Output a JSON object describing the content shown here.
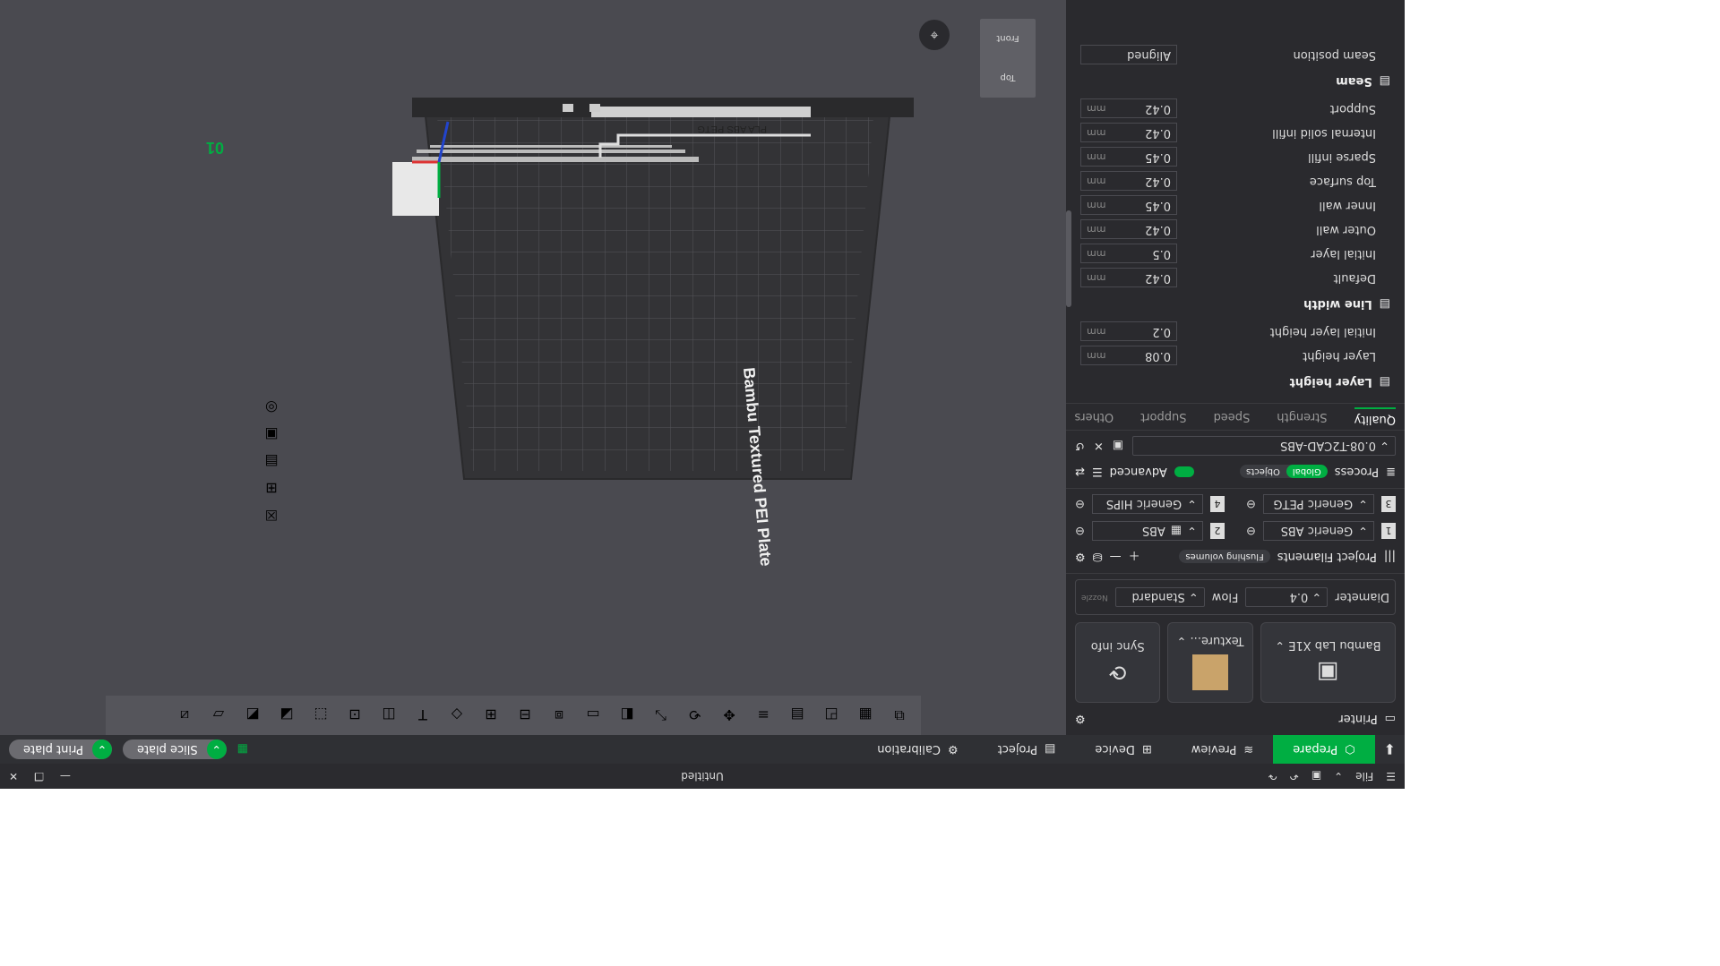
{
  "app": {
    "window_title": "Untitled",
    "menu_label": "File"
  },
  "nav": {
    "tabs": [
      {
        "label": "Prepare",
        "active": true
      },
      {
        "label": "Preview",
        "active": false
      },
      {
        "label": "Device",
        "active": false
      },
      {
        "label": "Project",
        "active": false
      },
      {
        "label": "Calibration",
        "active": false
      }
    ],
    "slice_label": "Slice plate",
    "print_label": "Print plate"
  },
  "printer": {
    "section_label": "Printer",
    "name": "Bambu Lab X1E",
    "plate_label": "Texture...",
    "sync_label": "Sync info",
    "nozzle_caption": "Nozzle",
    "diameter_label": "Diameter",
    "diameter_value": "0.4",
    "flow_label": "Flow",
    "flow_value": "Standard"
  },
  "filaments": {
    "section_label": "Project Filaments",
    "flushing_label": "Flushing volumes",
    "items": [
      {
        "num": "1",
        "name": "Generic ABS"
      },
      {
        "num": "2",
        "name": "ABS"
      },
      {
        "num": "3",
        "name": "Generic PETG"
      },
      {
        "num": "4",
        "name": "Generic HIPS"
      }
    ]
  },
  "process": {
    "section_label": "Process",
    "global_label": "Global",
    "objects_label": "Objects",
    "advanced_label": "Advanced",
    "preset": "0.08-T2CAD-ABS",
    "tabs": [
      "Quality",
      "Strength",
      "Speed",
      "Support",
      "Others"
    ],
    "groups": [
      {
        "title": "Layer height",
        "rows": [
          {
            "label": "Layer height",
            "value": "0.08",
            "unit": "mm"
          },
          {
            "label": "Initial layer height",
            "value": "0.2",
            "unit": "mm"
          }
        ]
      },
      {
        "title": "Line width",
        "rows": [
          {
            "label": "Default",
            "value": "0.42",
            "unit": "mm"
          },
          {
            "label": "Initial layer",
            "value": "0.5",
            "unit": "mm"
          },
          {
            "label": "Outer wall",
            "value": "0.42",
            "unit": "mm"
          },
          {
            "label": "Inner wall",
            "value": "0.45",
            "unit": "mm"
          },
          {
            "label": "Top surface",
            "value": "0.42",
            "unit": "mm"
          },
          {
            "label": "Sparse infill",
            "value": "0.45",
            "unit": "mm"
          },
          {
            "label": "Internal solid infill",
            "value": "0.42",
            "unit": "mm"
          },
          {
            "label": "Support",
            "value": "0.42",
            "unit": "mm"
          }
        ]
      },
      {
        "title": "Seam",
        "rows": [
          {
            "label": "Seam position",
            "value": "Aligned",
            "unit": ""
          }
        ]
      }
    ]
  },
  "viewport": {
    "plate_text": "Bambu Textured PEI Plate",
    "plate_number": "01",
    "header_text": "PLA ABS PETG",
    "viewcube_top": "Top",
    "viewcube_front": "Front",
    "axis_x": "x"
  },
  "colors": {
    "accent": "#00ae42",
    "background": "#4a4a50",
    "panel": "#2a2a2e"
  }
}
